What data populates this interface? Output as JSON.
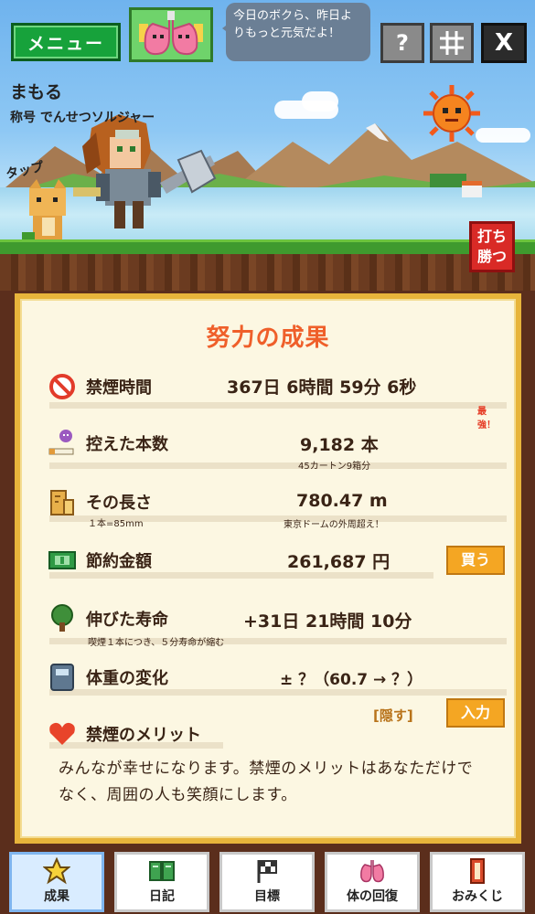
{
  "header": {
    "menu_label": "メニュー",
    "speech": "今日のボクら、昨日よりもっと元気だよ！",
    "help_label": "?",
    "share_x_label": "X"
  },
  "player": {
    "name": "まもる",
    "title": "称号 でんせつソルジャー",
    "tap_label": "タップ"
  },
  "fight_button": "打ち勝つ",
  "panel": {
    "title": "努力の成果",
    "rows": {
      "time": {
        "label": "禁煙時間",
        "value": "367日 6時間 59分 6秒",
        "note": "最強！"
      },
      "count": {
        "label": "控えた本数",
        "value": "9,182 本",
        "sub": "45カートン9箱分"
      },
      "length": {
        "label": "その長さ",
        "value": "780.47 m",
        "left_sub": "１本=85mm",
        "sub": "東京ドームの外周超え！"
      },
      "money": {
        "label": "節約金額",
        "value": "261,687 円",
        "button": "買う"
      },
      "life": {
        "label": "伸びた寿命",
        "value": "+31日 21時間 10分",
        "sub": "喫煙１本につき、５分寿命が縮む"
      },
      "weight": {
        "label": "体重の変化",
        "value": "± ？（60.7 → ？）",
        "hide_link": "[隠す]",
        "button": "入力"
      },
      "merit": {
        "label": "禁煙のメリット",
        "text": "みんなが幸せになります。禁煙のメリットはあなただけでなく、周囲の人も笑顔にします。"
      }
    }
  },
  "nav": {
    "items": [
      {
        "label": "成果",
        "icon": "star-icon"
      },
      {
        "label": "日記",
        "icon": "book-icon"
      },
      {
        "label": "目標",
        "icon": "flag-icon"
      },
      {
        "label": "体の回復",
        "icon": "lungs-icon"
      },
      {
        "label": "おみくじ",
        "icon": "omikuji-icon"
      }
    ],
    "active_index": 0
  },
  "colors": {
    "title_orange": "#ef5f2a",
    "button_orange": "#f4a623",
    "menu_green": "#17a23b",
    "fight_red": "#d92a26",
    "panel_border": "#e7b43b"
  }
}
